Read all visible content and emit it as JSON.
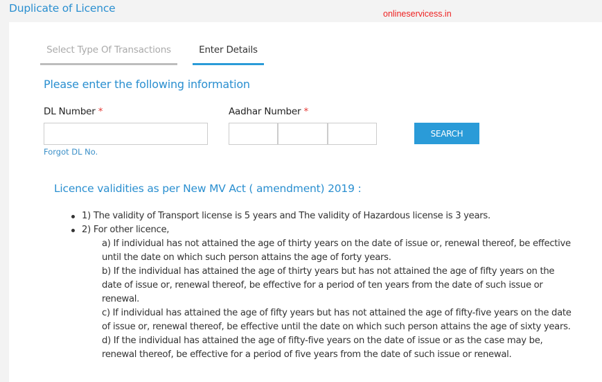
{
  "header": {
    "title": "Duplicate of Licence",
    "watermark": "onlineservicess.in"
  },
  "tabs": [
    {
      "label": "Select Type Of Transactions",
      "active": false
    },
    {
      "label": "Enter Details",
      "active": true
    }
  ],
  "form": {
    "section_title": "Please enter the following information",
    "dl_number": {
      "label": "DL Number",
      "required_mark": "*",
      "value": "",
      "placeholder": ""
    },
    "aadhar_number": {
      "label": "Aadhar Number",
      "required_mark": "*",
      "parts": [
        {
          "value": ""
        },
        {
          "value": ""
        },
        {
          "value": ""
        }
      ]
    },
    "forgot_link": "Forgot DL No.",
    "search_button": "SEARCH"
  },
  "validity": {
    "title": "Licence validities as per New MV Act ( amendment) 2019 :",
    "items": [
      "1) The validity of Transport license is 5 years and The validity of Hazardous license is 3 years.",
      "2) For other licence,"
    ],
    "sub_items": [
      "a) If individual has not attained the age of thirty years on the date of issue or, renewal thereof, be effective until the date on which such person attains the age of forty years.",
      "b) If the individual has attained the age of thirty years but has not attained the age of fifty years on the date of issue or, renewal thereof, be effective for a period of ten years from the date of such issue or renewal.",
      "c) If individual has attained the age of fifty years but has not attained the age of fifty-five years on the date of issue or, renewal thereof, be effective until the date on which such person attains the age of sixty years.",
      "d) If the individual has attained the age of fifty-five years on the date of issue or as the case may be, renewal thereof, be effective for a period of five years from the date of such issue or renewal."
    ]
  },
  "colors": {
    "accent": "#2a9bd8",
    "title_blue": "#2a8fd0",
    "required_red": "#e53935",
    "watermark_red": "#ee2222",
    "background": "#f3f3f3"
  }
}
